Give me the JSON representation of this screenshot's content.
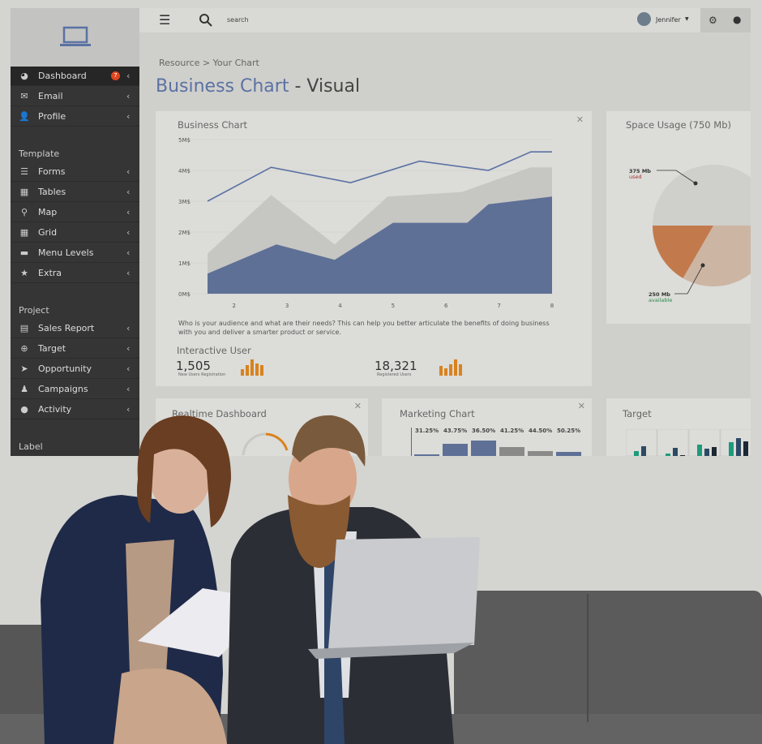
{
  "header": {
    "search_placeholder": "search",
    "user": "Jennifer"
  },
  "sidebar": {
    "items": [
      {
        "label": "Dashboard",
        "icon": "pie-chart-icon",
        "badge": "7",
        "active": true
      },
      {
        "label": "Email",
        "icon": "envelope-icon"
      },
      {
        "label": "Profile",
        "icon": "user-icon"
      }
    ],
    "template_heading": "Template",
    "template_items": [
      {
        "label": "Forms",
        "icon": "lines-icon"
      },
      {
        "label": "Tables",
        "icon": "table-icon"
      },
      {
        "label": "Map",
        "icon": "map-pin-icon"
      },
      {
        "label": "Grid",
        "icon": "grid-icon"
      },
      {
        "label": "Menu Levels",
        "icon": "folder-icon"
      },
      {
        "label": "Extra",
        "icon": "star-icon"
      }
    ],
    "project_heading": "Project",
    "project_items": [
      {
        "label": "Sales Report",
        "icon": "report-icon"
      },
      {
        "label": "Target",
        "icon": "crosshair-icon"
      },
      {
        "label": "Opportunity",
        "icon": "rocket-icon"
      },
      {
        "label": "Campaigns",
        "icon": "users-icon"
      },
      {
        "label": "Activity",
        "icon": "chat-icon"
      }
    ],
    "label_heading": "Label"
  },
  "page": {
    "breadcrumb": "Resource > Your Chart",
    "title_accent": "Business Chart",
    "title_rest": " - Visual"
  },
  "business_chart": {
    "title": "Business Chart",
    "description": "Who is your audience and what are their needs? This can help you better articulate the benefits of doing business with you and deliver a smarter product or service.",
    "interactive_title": "Interactive User",
    "stat1_value": "1,505",
    "stat1_label": "New Users Registration",
    "stat2_value": "18,321",
    "stat2_label": "Registered Users"
  },
  "space_usage": {
    "title": "Space Usage (750 Mb)",
    "used_value": "375 Mb",
    "used_label": "used",
    "avail_value": "250 Mb",
    "avail_label": "available"
  },
  "realtime": {
    "title": "Realtime Dashboard"
  },
  "marketing": {
    "title": "Marketing Chart"
  },
  "target": {
    "title": "Target"
  },
  "chart_data": [
    {
      "type": "area",
      "title": "Business Chart",
      "xlim": [
        1.5,
        8
      ],
      "ylim": [
        0,
        5
      ],
      "xticks": [
        "2",
        "3",
        "4",
        "5",
        "6",
        "7",
        "8"
      ],
      "yticks": [
        "0M$",
        "1M$",
        "2M$",
        "3M$",
        "4M$",
        "5M$"
      ],
      "line": {
        "color": "#5b72a3",
        "points": [
          [
            1.5,
            3.0
          ],
          [
            2.7,
            4.1
          ],
          [
            4.2,
            3.6
          ],
          [
            5.5,
            4.3
          ],
          [
            6.8,
            4.0
          ],
          [
            7.6,
            4.6
          ],
          [
            8,
            4.6
          ]
        ]
      },
      "gray_area": {
        "color": "#c6c6c3",
        "points": [
          [
            1.5,
            1.3
          ],
          [
            2.7,
            3.2
          ],
          [
            3.9,
            1.6
          ],
          [
            4.9,
            3.15
          ],
          [
            6.3,
            3.3
          ],
          [
            7.6,
            4.1
          ],
          [
            8,
            4.1
          ]
        ]
      },
      "blue_area": {
        "color": "#5e7096",
        "points": [
          [
            1.5,
            0.65
          ],
          [
            2.8,
            1.6
          ],
          [
            3.9,
            1.1
          ],
          [
            5.0,
            2.3
          ],
          [
            6.4,
            2.3
          ],
          [
            6.8,
            2.9
          ],
          [
            8,
            3.15
          ]
        ]
      }
    },
    {
      "type": "pie",
      "title": "Space Usage (750 Mb)",
      "slices": [
        {
          "label": "used",
          "value": 375,
          "color": "#cfcfcc"
        },
        {
          "label": "available",
          "value": 250,
          "color": "#cdb5a4"
        },
        {
          "label": "",
          "value": 125,
          "color": "#c27a4c"
        }
      ]
    },
    {
      "type": "bar",
      "title": "Marketing Chart",
      "labels": [
        "31.25%",
        "43.75%",
        "36.50%",
        "41.25%",
        "44.50%",
        "50.25%"
      ],
      "colors": [
        "#5e7096",
        "#5e7096",
        "#5e7096",
        "#8a8a88",
        "#8a8a88",
        "#5e7096"
      ],
      "relative_heights": [
        0.1,
        0.75,
        0.95,
        0.55,
        0.3,
        0.25
      ]
    }
  ]
}
